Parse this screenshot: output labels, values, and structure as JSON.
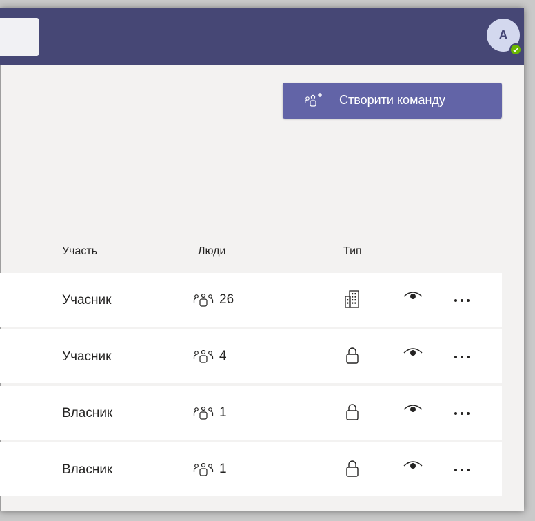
{
  "header": {
    "avatar_initial": "A",
    "brand_color": "#464775",
    "status_color": "#6bb700"
  },
  "toolbar": {
    "create_team_label": "Створити команду",
    "create_team_icon": "add-people-icon",
    "accent": "#6264a7"
  },
  "table": {
    "columns": {
      "role": "Участь",
      "people": "Люди",
      "type": "Тип"
    },
    "rows": [
      {
        "role": "Учасник",
        "people": "26",
        "type_icon": "building-icon"
      },
      {
        "role": "Учасник",
        "people": "4",
        "type_icon": "lock-icon"
      },
      {
        "role": "Власник",
        "people": "1",
        "type_icon": "lock-icon"
      },
      {
        "role": "Власник",
        "people": "1",
        "type_icon": "lock-icon"
      }
    ]
  }
}
